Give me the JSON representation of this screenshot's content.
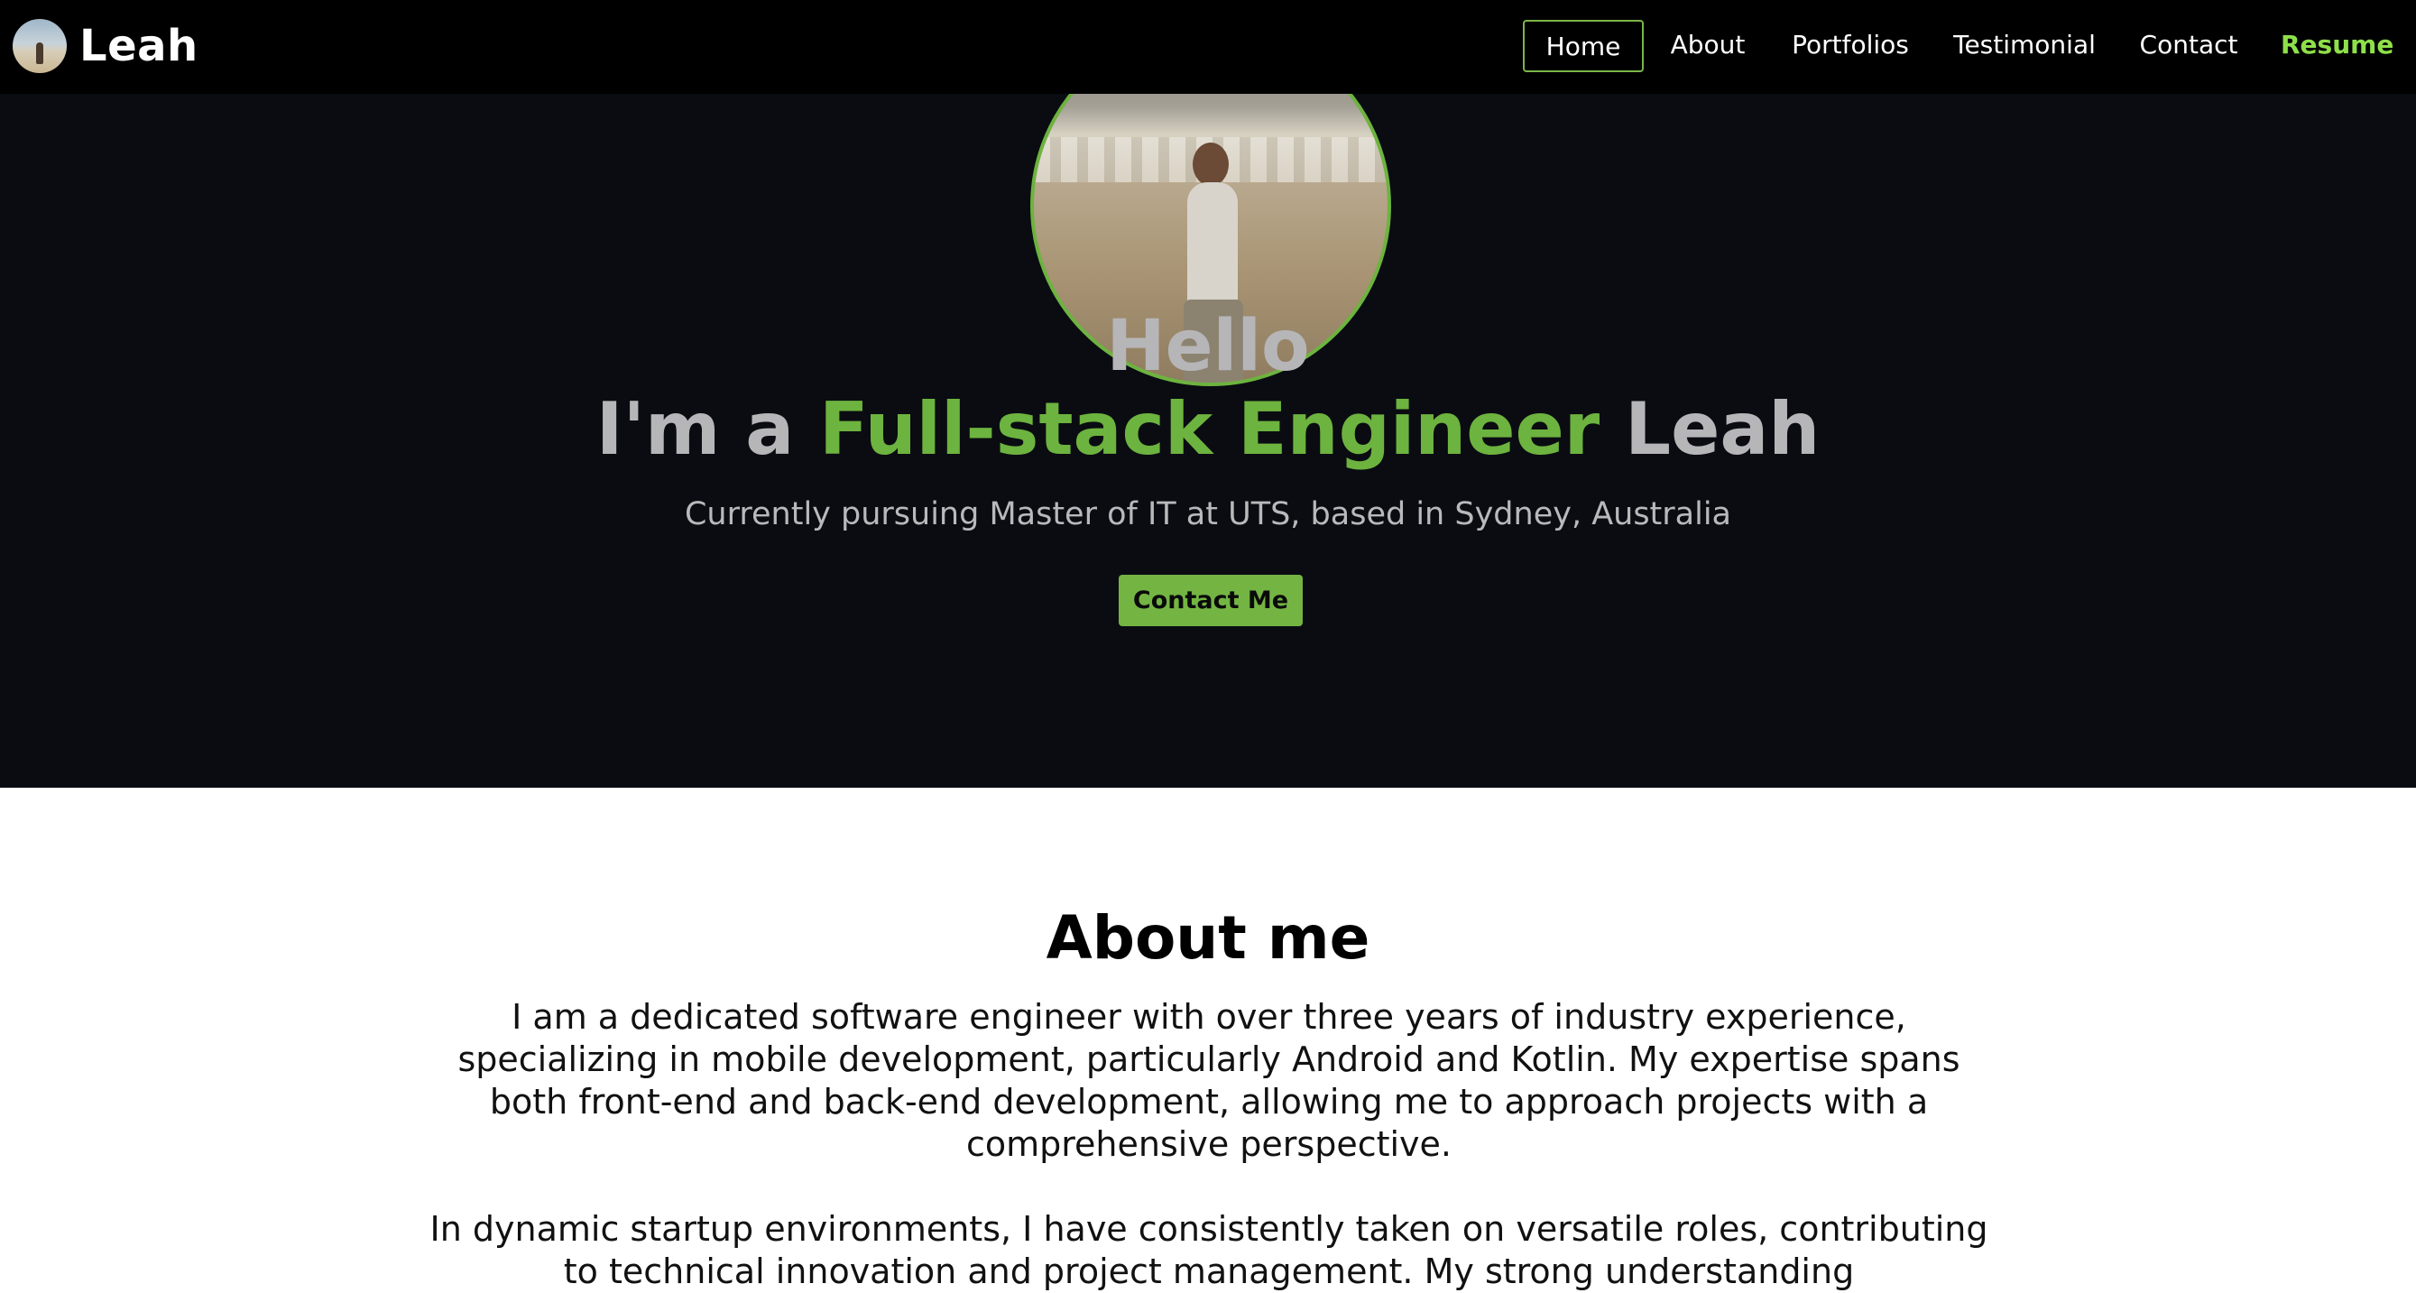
{
  "navbar": {
    "brand_name": "Leah",
    "items": [
      {
        "label": "Home"
      },
      {
        "label": "About"
      },
      {
        "label": "Portfolios"
      },
      {
        "label": "Testimonial"
      },
      {
        "label": "Contact"
      },
      {
        "label": "Resume"
      }
    ],
    "active_item": "Home"
  },
  "hero": {
    "greeting": "Hello",
    "headline_prefix": "I'm a ",
    "headline_role": "Full-stack Engineer",
    "headline_suffix": " Leah",
    "subtitle": "Currently pursuing Master of IT at UTS, based in Sydney, Australia",
    "cta_label": "Contact Me"
  },
  "about": {
    "title": "About me",
    "paragraph_1": "I am a dedicated software engineer with over three years of industry experience, specializing in mobile development, particularly Android and Kotlin. My expertise spans both front-end and back-end development, allowing me to approach projects with a comprehensive perspective.",
    "paragraph_2": "In dynamic startup environments, I have consistently taken on versatile roles, contributing to technical innovation and project management. My strong understanding"
  },
  "colors": {
    "accent": "#6db33f",
    "resume": "#8ee04a",
    "hero_bg": "#0a0c12",
    "nav_bg": "#000000"
  }
}
